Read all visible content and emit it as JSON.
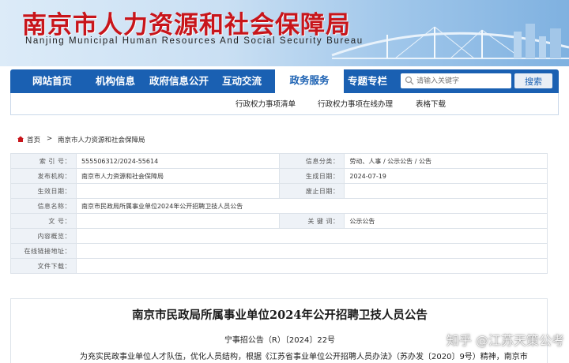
{
  "header": {
    "title": "南京市人力资源和社会保障局",
    "subtitle": "Nanjing Municipal Human Resources And Social Security Bureau"
  },
  "nav": {
    "items": [
      "网站首页",
      "机构信息",
      "政府信息公开",
      "互动交流"
    ],
    "active": "政务服务",
    "after": "专题专栏",
    "search_placeholder": "请输入关键字",
    "search_button": "搜索"
  },
  "subnav": {
    "items": [
      "行政权力事项清单",
      "行政权力事项在线办理",
      "表格下载"
    ]
  },
  "breadcrumb": {
    "home": "首页",
    "sep": ">",
    "current": "南京市人力资源和社会保障局"
  },
  "info": {
    "rows": [
      {
        "l1": "索 引 号：",
        "v1": "555506312/2024-55614",
        "l2": "信息分类：",
        "v2": "劳动、人事 / 公示公告 / 公告"
      },
      {
        "l1": "发布机构：",
        "v1": "南京市人力资源和社会保障局",
        "l2": "生成日期：",
        "v2": "2024-07-19"
      },
      {
        "l1": "生效日期：",
        "v1": "",
        "l2": "废止日期：",
        "v2": ""
      },
      {
        "l1": "信息名称：",
        "v1": "南京市民政局所属事业单位2024年公开招聘卫技人员公告"
      },
      {
        "l1": "文      号：",
        "v1": "",
        "l2": "关 键 词：",
        "v2": "公示公告"
      },
      {
        "l1": "内容概览：",
        "v1": ""
      },
      {
        "l1": "在线链接地址：",
        "v1": ""
      },
      {
        "l1": "文件下载：",
        "v1": ""
      }
    ]
  },
  "article": {
    "title": "南京市民政局所属事业单位2024年公开招聘卫技人员公告",
    "doc_no": "宁事招公告（R）〔2024〕22号",
    "body_start": "为充实民政事业单位人才队伍，优化人员结构，根据《江苏省事业单位公开招聘人员办法》（苏办发〔2020〕9号）精神，南京市"
  },
  "watermark": "知乎 @江苏天策公考"
}
